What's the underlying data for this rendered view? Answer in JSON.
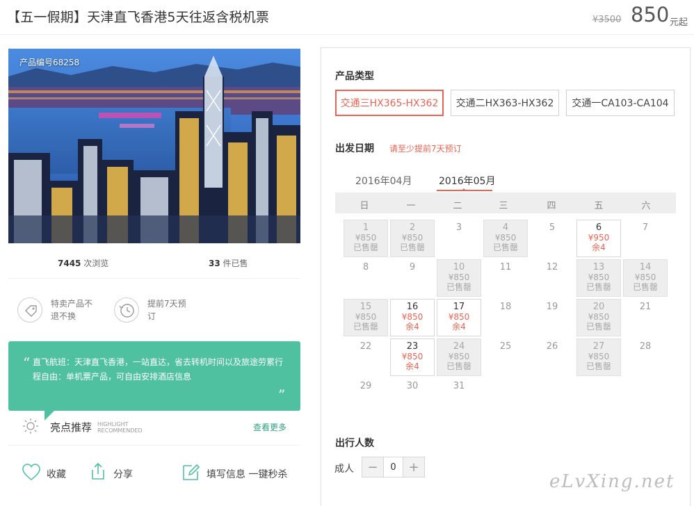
{
  "header": {
    "title": "【五一假期】天津直飞香港5天往返含税机票",
    "old_price": "¥3500",
    "price": "850",
    "price_unit": "元起"
  },
  "product": {
    "code_label": "产品编号68258",
    "views_count": "7445",
    "views_label": "次浏览",
    "sold_count": "33",
    "sold_label": "件已售"
  },
  "features": [
    {
      "icon": "tag-icon",
      "text": "特卖产品不退不换"
    },
    {
      "icon": "clock-icon",
      "text": "提前7天预订"
    }
  ],
  "quote": {
    "open": "“",
    "close": "”",
    "text": "直飞航班：天津直飞香港，一站直达，省去转机时间以及旅途劳累行程自由：单机票产品，可自由安排酒店信息"
  },
  "highlight": {
    "icon": "sun-icon",
    "title": "亮点推荐",
    "en_line1": "HIGHLIGHT",
    "en_line2": "RECOMMENDED",
    "more_link": "查看更多"
  },
  "actions": [
    {
      "icon": "heart-icon",
      "label": "收藏"
    },
    {
      "icon": "share-icon",
      "label": "分享"
    },
    {
      "icon": "edit-icon",
      "label": "填写信息 一键秒杀"
    }
  ],
  "booking": {
    "type_label": "产品类型",
    "types": [
      {
        "label": "交通三HX365-HX362",
        "selected": true
      },
      {
        "label": "交通二HX363-HX362",
        "selected": false
      },
      {
        "label": "交通一CA103-CA104",
        "selected": false
      }
    ],
    "date_label": "出发日期",
    "date_notice": "请至少提前7天预订",
    "months": [
      "2016年04月",
      "2016年05月"
    ],
    "active_month": "2016年05月",
    "weekdays": [
      "日",
      "一",
      "二",
      "三",
      "四",
      "五",
      "六"
    ],
    "days": [
      {
        "d": "1",
        "state": "soldout",
        "price": "¥850",
        "status": "已售罄"
      },
      {
        "d": "2",
        "state": "soldout",
        "price": "¥850",
        "status": "已售罄"
      },
      {
        "d": "3",
        "state": "plain"
      },
      {
        "d": "4",
        "state": "soldout",
        "price": "¥850",
        "status": "已售罄"
      },
      {
        "d": "5",
        "state": "plain"
      },
      {
        "d": "6",
        "state": "avail",
        "price": "¥950",
        "status": "余4"
      },
      {
        "d": "7",
        "state": "plain"
      },
      {
        "d": "8",
        "state": "plain"
      },
      {
        "d": "9",
        "state": "plain"
      },
      {
        "d": "10",
        "state": "soldout",
        "price": "¥850",
        "status": "已售罄"
      },
      {
        "d": "11",
        "state": "plain"
      },
      {
        "d": "12",
        "state": "plain"
      },
      {
        "d": "13",
        "state": "soldout",
        "price": "¥850",
        "status": "已售罄"
      },
      {
        "d": "14",
        "state": "soldout",
        "price": "¥850",
        "status": "已售罄"
      },
      {
        "d": "15",
        "state": "soldout",
        "price": "¥850",
        "status": "已售罄"
      },
      {
        "d": "16",
        "state": "avail",
        "price": "¥850",
        "status": "余4"
      },
      {
        "d": "17",
        "state": "avail",
        "price": "¥850",
        "status": "余4"
      },
      {
        "d": "18",
        "state": "plain"
      },
      {
        "d": "19",
        "state": "plain"
      },
      {
        "d": "20",
        "state": "soldout",
        "price": "¥850",
        "status": "已售罄"
      },
      {
        "d": "21",
        "state": "plain"
      },
      {
        "d": "22",
        "state": "plain"
      },
      {
        "d": "23",
        "state": "avail",
        "price": "¥850",
        "status": "余4"
      },
      {
        "d": "24",
        "state": "soldout",
        "price": "¥850",
        "status": "已售罄"
      },
      {
        "d": "25",
        "state": "plain"
      },
      {
        "d": "26",
        "state": "plain"
      },
      {
        "d": "27",
        "state": "soldout",
        "price": "¥850",
        "status": "已售罄"
      },
      {
        "d": "28",
        "state": "plain"
      },
      {
        "d": "29",
        "state": "plain"
      },
      {
        "d": "30",
        "state": "plain"
      },
      {
        "d": "31",
        "state": "plain"
      }
    ],
    "travellers_label": "出行人数",
    "adult_label": "成人",
    "adult_count": "0",
    "minus": "−",
    "plus": "+"
  },
  "watermark": "eLvXing.net",
  "colors": {
    "accent_red": "#e86452",
    "quote_green": "#4fc1a1",
    "link_green": "#2ea37f"
  }
}
